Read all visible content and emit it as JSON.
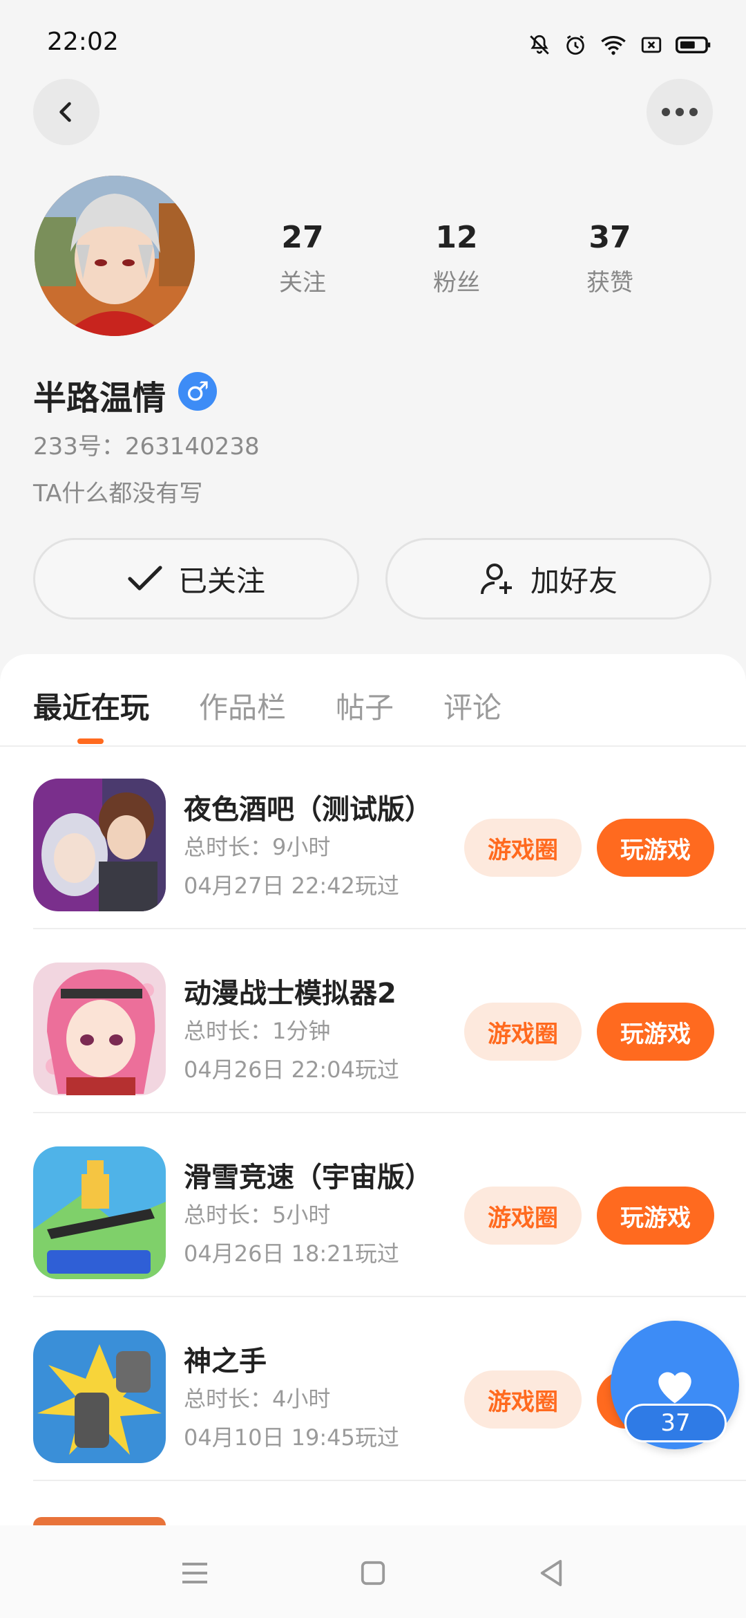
{
  "status_bar": {
    "time": "22:02"
  },
  "profile": {
    "stats": [
      {
        "value": "27",
        "label": "关注"
      },
      {
        "value": "12",
        "label": "粉丝"
      },
      {
        "value": "37",
        "label": "获赞"
      }
    ],
    "name": "半路温情",
    "gender_symbol": "♂",
    "uid": "233号：263140238",
    "bio": "TA什么都没有写"
  },
  "actions": {
    "follow_label": "已关注",
    "add_friend_label": "加好友"
  },
  "tabs": [
    {
      "label": "最近在玩",
      "active": true
    },
    {
      "label": "作品栏",
      "active": false
    },
    {
      "label": "帖子",
      "active": false
    },
    {
      "label": "评论",
      "active": false
    }
  ],
  "games": [
    {
      "title": "夜色酒吧（测试版）",
      "duration": "总时长：9小时",
      "last_played": "04月27日 22:42玩过",
      "circle_label": "游戏圈",
      "play_label": "玩游戏"
    },
    {
      "title": "动漫战士模拟器2",
      "duration": "总时长：1分钟",
      "last_played": "04月26日 22:04玩过",
      "circle_label": "游戏圈",
      "play_label": "玩游戏"
    },
    {
      "title": "滑雪竞速（宇宙版）",
      "duration": "总时长：5小时",
      "last_played": "04月26日 18:21玩过",
      "circle_label": "游戏圈",
      "play_label": "玩游戏"
    },
    {
      "title": "神之手",
      "duration": "总时长：4小时",
      "last_played": "04月10日 19:45玩过",
      "circle_label": "游戏圈",
      "play_label": "玩游戏"
    }
  ],
  "like_fab": {
    "count": "37"
  },
  "colors": {
    "accent": "#ff6a1f",
    "blue": "#3d8cf6"
  }
}
